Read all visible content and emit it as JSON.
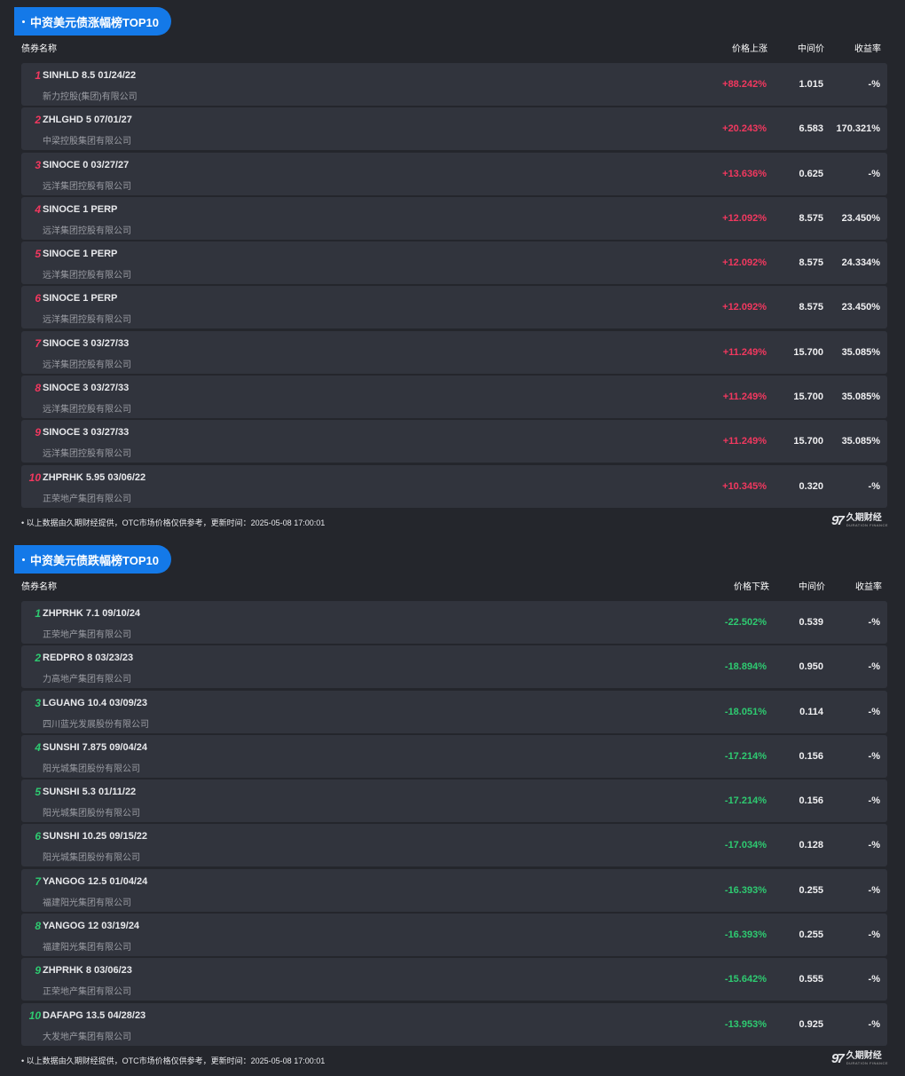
{
  "gainers": {
    "title": "中资美元债涨幅榜TOP10",
    "columns": {
      "name": "债券名称",
      "change": "价格上涨",
      "mid": "中间价",
      "yield": "收益率"
    },
    "rows": [
      {
        "rank": "1",
        "code": "SINHLD 8.5 01/24/22",
        "issuer": "新力控股(集团)有限公司",
        "change": "+88.242%",
        "mid": "1.015",
        "yield": "-%"
      },
      {
        "rank": "2",
        "code": "ZHLGHD 5 07/01/27",
        "issuer": "中梁控股集团有限公司",
        "change": "+20.243%",
        "mid": "6.583",
        "yield": "170.321%"
      },
      {
        "rank": "3",
        "code": "SINOCE 0 03/27/27",
        "issuer": "远洋集团控股有限公司",
        "change": "+13.636%",
        "mid": "0.625",
        "yield": "-%"
      },
      {
        "rank": "4",
        "code": "SINOCE 1 PERP",
        "issuer": "远洋集团控股有限公司",
        "change": "+12.092%",
        "mid": "8.575",
        "yield": "23.450%"
      },
      {
        "rank": "5",
        "code": "SINOCE 1 PERP",
        "issuer": "远洋集团控股有限公司",
        "change": "+12.092%",
        "mid": "8.575",
        "yield": "24.334%"
      },
      {
        "rank": "6",
        "code": "SINOCE 1 PERP",
        "issuer": "远洋集团控股有限公司",
        "change": "+12.092%",
        "mid": "8.575",
        "yield": "23.450%"
      },
      {
        "rank": "7",
        "code": "SINOCE 3 03/27/33",
        "issuer": "远洋集团控股有限公司",
        "change": "+11.249%",
        "mid": "15.700",
        "yield": "35.085%"
      },
      {
        "rank": "8",
        "code": "SINOCE 3 03/27/33",
        "issuer": "远洋集团控股有限公司",
        "change": "+11.249%",
        "mid": "15.700",
        "yield": "35.085%"
      },
      {
        "rank": "9",
        "code": "SINOCE 3 03/27/33",
        "issuer": "远洋集团控股有限公司",
        "change": "+11.249%",
        "mid": "15.700",
        "yield": "35.085%"
      },
      {
        "rank": "10",
        "code": "ZHPRHK 5.95 03/06/22",
        "issuer": "正荣地产集团有限公司",
        "change": "+10.345%",
        "mid": "0.320",
        "yield": "-%"
      }
    ],
    "footer_note": "• 以上数据由久期财经提供，OTC市场价格仅供参考，更新时间：2025-05-08 17:00:01"
  },
  "losers": {
    "title": "中资美元债跌幅榜TOP10",
    "columns": {
      "name": "债券名称",
      "change": "价格下跌",
      "mid": "中间价",
      "yield": "收益率"
    },
    "rows": [
      {
        "rank": "1",
        "code": "ZHPRHK 7.1 09/10/24",
        "issuer": "正荣地产集团有限公司",
        "change": "-22.502%",
        "mid": "0.539",
        "yield": "-%"
      },
      {
        "rank": "2",
        "code": "REDPRO 8 03/23/23",
        "issuer": "力高地产集团有限公司",
        "change": "-18.894%",
        "mid": "0.950",
        "yield": "-%"
      },
      {
        "rank": "3",
        "code": "LGUANG 10.4 03/09/23",
        "issuer": "四川蓝光发展股份有限公司",
        "change": "-18.051%",
        "mid": "0.114",
        "yield": "-%"
      },
      {
        "rank": "4",
        "code": "SUNSHI 7.875 09/04/24",
        "issuer": "阳光城集团股份有限公司",
        "change": "-17.214%",
        "mid": "0.156",
        "yield": "-%"
      },
      {
        "rank": "5",
        "code": "SUNSHI 5.3 01/11/22",
        "issuer": "阳光城集团股份有限公司",
        "change": "-17.214%",
        "mid": "0.156",
        "yield": "-%"
      },
      {
        "rank": "6",
        "code": "SUNSHI 10.25 09/15/22",
        "issuer": "阳光城集团股份有限公司",
        "change": "-17.034%",
        "mid": "0.128",
        "yield": "-%"
      },
      {
        "rank": "7",
        "code": "YANGOG 12.5 01/04/24",
        "issuer": "福建阳光集团有限公司",
        "change": "-16.393%",
        "mid": "0.255",
        "yield": "-%"
      },
      {
        "rank": "8",
        "code": "YANGOG 12 03/19/24",
        "issuer": "福建阳光集团有限公司",
        "change": "-16.393%",
        "mid": "0.255",
        "yield": "-%"
      },
      {
        "rank": "9",
        "code": "ZHPRHK 8 03/06/23",
        "issuer": "正荣地产集团有限公司",
        "change": "-15.642%",
        "mid": "0.555",
        "yield": "-%"
      },
      {
        "rank": "10",
        "code": "DAFAPG 13.5 04/28/23",
        "issuer": "大发地产集团有限公司",
        "change": "-13.953%",
        "mid": "0.925",
        "yield": "-%"
      }
    ],
    "footer_note": "• 以上数据由久期财经提供，OTC市场价格仅供参考，更新时间：2025-05-08 17:00:01"
  },
  "brand": {
    "logo_mark": "97",
    "name_cn": "久期财经",
    "name_en": "DURATION FINANCE"
  },
  "colors": {
    "background": "#24262c",
    "row": "#31343d",
    "accent": "#1479e8",
    "up": "#f2385f",
    "down": "#2ecb71"
  }
}
